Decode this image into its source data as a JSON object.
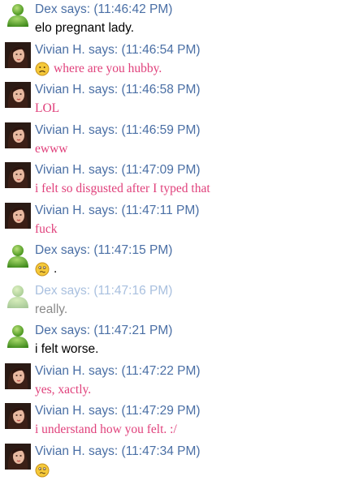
{
  "messages": [
    {
      "sender": "Dex",
      "header": "Dex says: (11:46:42 PM)",
      "text": "elo pregnant lady.",
      "avatar": "buddy-icon",
      "emoji": "",
      "style": "dex"
    },
    {
      "sender": "Vivian H.",
      "header": "Vivian H. says: (11:46:54 PM)",
      "text": "where are you hubby.",
      "avatar": "photo-avatar",
      "emoji": "frown-emoji-icon",
      "style": "viv"
    },
    {
      "sender": "Vivian H.",
      "header": "Vivian H. says: (11:46:58 PM)",
      "text": "LOL",
      "avatar": "photo-avatar",
      "emoji": "",
      "style": "viv"
    },
    {
      "sender": "Vivian H.",
      "header": "Vivian H. says: (11:46:59 PM)",
      "text": "ewww",
      "avatar": "photo-avatar",
      "emoji": "",
      "style": "viv"
    },
    {
      "sender": "Vivian H.",
      "header": "Vivian H. says: (11:47:09 PM)",
      "text": "i felt so disgusted after I typed that",
      "avatar": "photo-avatar",
      "emoji": "",
      "style": "viv"
    },
    {
      "sender": "Vivian H.",
      "header": "Vivian H. says: (11:47:11 PM)",
      "text": "fuck",
      "avatar": "photo-avatar",
      "emoji": "",
      "style": "viv"
    },
    {
      "sender": "Dex",
      "header": "Dex says: (11:47:15 PM)",
      "text": ".",
      "avatar": "buddy-icon",
      "emoji": "worried-emoji-icon",
      "style": "dex"
    },
    {
      "sender": "Dex",
      "header": "Dex says: (11:47:16 PM)",
      "text": "really.",
      "avatar": "buddy-icon",
      "emoji": "",
      "style": "faded"
    },
    {
      "sender": "Dex",
      "header": "Dex says: (11:47:21 PM)",
      "text": "i felt worse.",
      "avatar": "buddy-icon",
      "emoji": "",
      "style": "dex"
    },
    {
      "sender": "Vivian H.",
      "header": "Vivian H. says: (11:47:22 PM)",
      "text": "yes, xactly.",
      "avatar": "photo-avatar",
      "emoji": "",
      "style": "viv"
    },
    {
      "sender": "Vivian H.",
      "header": "Vivian H. says: (11:47:29 PM)",
      "text": "i understand how you felt. :/",
      "avatar": "photo-avatar",
      "emoji": "",
      "style": "viv"
    },
    {
      "sender": "Vivian H.",
      "header": "Vivian H. says: (11:47:34 PM)",
      "text": "",
      "avatar": "photo-avatar",
      "emoji": "worried-emoji-icon",
      "style": "viv"
    }
  ],
  "colors": {
    "header_text": "#4a6fa5",
    "vivian_text": "#e0407b",
    "dex_text": "#000000",
    "faded_text": "#8a8a8a"
  }
}
